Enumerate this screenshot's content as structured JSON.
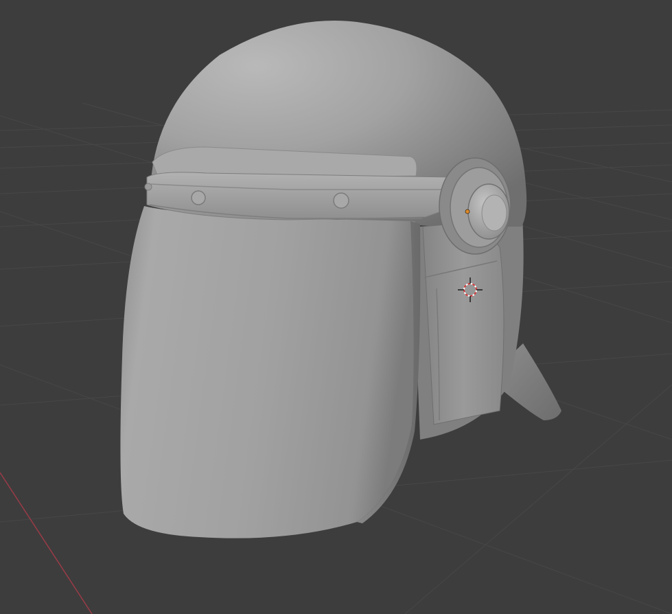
{
  "viewport": {
    "background_color": "#3d3d3d",
    "grid_line_color": "#474747",
    "x_axis_color": "#9a3b47"
  },
  "scene": {
    "object": "riot-helmet-mesh",
    "shading": "solid-gray",
    "object_color": "#9b9b9b",
    "origin_dot_color": "#e08a2a",
    "icons": [
      "3d-cursor-icon",
      "object-origin-icon"
    ]
  }
}
